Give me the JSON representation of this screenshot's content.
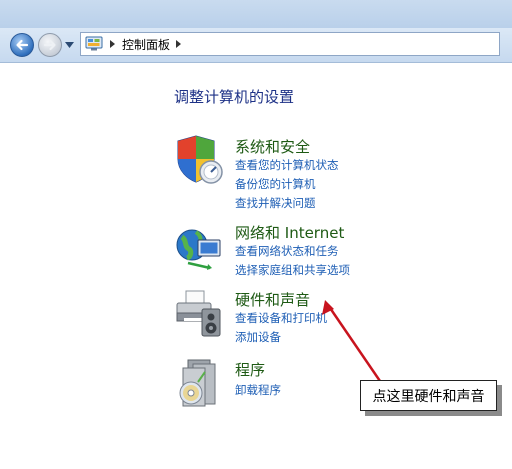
{
  "address_bar": {
    "path": "控制面板"
  },
  "page": {
    "title": "调整计算机的设置"
  },
  "categories": [
    {
      "title": "系统和安全",
      "icon": "shield-system-icon",
      "links": [
        "查看您的计算机状态",
        "备份您的计算机",
        "查找并解决问题"
      ]
    },
    {
      "title": "网络和 Internet",
      "icon": "network-globe-icon",
      "links": [
        "查看网络状态和任务",
        "选择家庭组和共享选项"
      ]
    },
    {
      "title": "硬件和声音",
      "icon": "printer-speaker-icon",
      "links": [
        "查看设备和打印机",
        "添加设备"
      ]
    },
    {
      "title": "程序",
      "icon": "programs-disc-icon",
      "links": [
        "卸载程序"
      ]
    }
  ],
  "annotation": {
    "callout_text": "点这里硬件和声音",
    "arrow_color": "#c8141e"
  },
  "colors": {
    "category_title": "#1e5a14",
    "link": "#1f5fb5",
    "page_title": "#1e3287"
  }
}
